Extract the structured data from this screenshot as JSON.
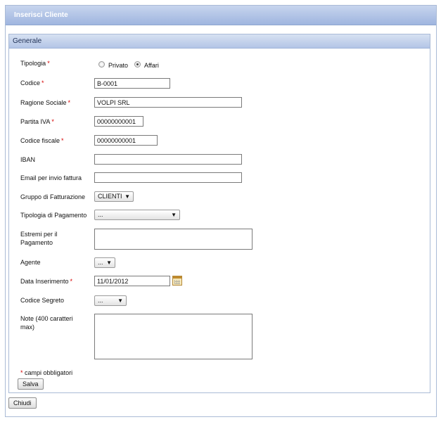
{
  "window": {
    "title": "Inserisci Cliente"
  },
  "panel": {
    "title": "Generale"
  },
  "form": {
    "tipologia": {
      "label": "Tipologia",
      "options": [
        "Privato",
        "Affari"
      ],
      "selected": "Affari"
    },
    "codice": {
      "label": "Codice",
      "value": "B-0001"
    },
    "ragione_sociale": {
      "label": "Ragione Sociale",
      "value": "VOLPI SRL"
    },
    "partita_iva": {
      "label": "Partita IVA",
      "value": "00000000001"
    },
    "codice_fiscale": {
      "label": "Codice fiscale",
      "value": "00000000001"
    },
    "iban": {
      "label": "IBAN",
      "value": ""
    },
    "email_fattura": {
      "label": "Email per invio fattura",
      "value": ""
    },
    "gruppo_fatturazione": {
      "label": "Gruppo di Fatturazione",
      "value": "CLIENTI"
    },
    "tipologia_pagamento": {
      "label": "Tipologia di Pagamento",
      "value": "..."
    },
    "estremi_pagamento": {
      "label_line1": "Estremi per il",
      "label_line2": "Pagamento",
      "value": ""
    },
    "agente": {
      "label": "Agente",
      "value": "..."
    },
    "data_inserimento": {
      "label": "Data Inserimento",
      "value": "11/01/2012"
    },
    "codice_segreto": {
      "label": "Codice Segreto",
      "value": "..."
    },
    "note": {
      "label_line1": "Note (400 caratteri",
      "label_line2": "max)",
      "value": ""
    },
    "required_marker": "*",
    "required_note": "campi obbligatori",
    "save_label": "Salva"
  },
  "close_label": "Chiudi",
  "colors": {
    "titlebar": "#9fb5df",
    "required": "#d60000"
  },
  "icons": {
    "dropdown": "chevron-down-icon",
    "calendar": "calendar-icon"
  }
}
